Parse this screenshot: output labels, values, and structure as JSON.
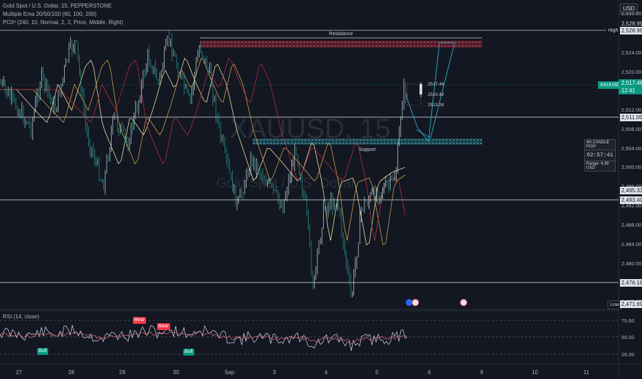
{
  "header": {
    "symbol_line": "Gold Spot / U.S. Dollar, 15, PEPPERSTONE",
    "ema_line": "Multiple Ema 20/50/100 (60, 100, 200)",
    "po3_line": "PO3³ (240, 10, Normal, 2, 2, Price, Middle, Right)"
  },
  "currency": "USD",
  "watermark": {
    "symbol": "XAUUSD, 15",
    "name": "Gold Spot / U.S. Dollar"
  },
  "price_axis": {
    "ticks": [
      "2,532.00",
      "2,528.00",
      "2,524.00",
      "2,520.00",
      "2,516.00",
      "2,512.00",
      "2,508.00",
      "2,504.00",
      "2,500.00",
      "2,496.00",
      "2,492.00",
      "2,488.00",
      "2,484.00",
      "2,480.00",
      "2,476.00",
      "2,472.00"
    ],
    "high_tag": "High",
    "high_value": "2,528.96",
    "prev_value": "2,528.99",
    "current_symbol": "XAUUSD",
    "current_value": "2,517.46",
    "countdown": "12:41",
    "level1": "2,511.05",
    "level2": "2,495.33",
    "level3": "2,493.49",
    "level4": "2,476.18",
    "low_tag": "Low",
    "low_value": "2,471.69"
  },
  "zones": {
    "resistance": "Resistance",
    "support": "Support"
  },
  "po3": {
    "price_hi": "2517.46",
    "price_mid": "2515.42",
    "price_lo": "2513.28",
    "box_title": "4H CANDLE PO3³",
    "timer": "02:57:41",
    "range": "Range: 4.39 USD"
  },
  "rsi": {
    "title": "RSI (14, close)",
    "levels": [
      "75.00",
      "50.00",
      "25.00"
    ],
    "labels": [
      "Bull",
      "Bear",
      "Bear",
      "Bull"
    ]
  },
  "time_axis": [
    "27",
    "28",
    "29",
    "30",
    "Sep",
    "3",
    "4",
    "5",
    "6",
    "9",
    "10",
    "11"
  ],
  "colors": {
    "bg": "#131722",
    "up": "#26a69a",
    "down": "#ef5350",
    "accent": "#089981",
    "resistance": "#d9404f",
    "support": "#2aa6b8"
  }
}
